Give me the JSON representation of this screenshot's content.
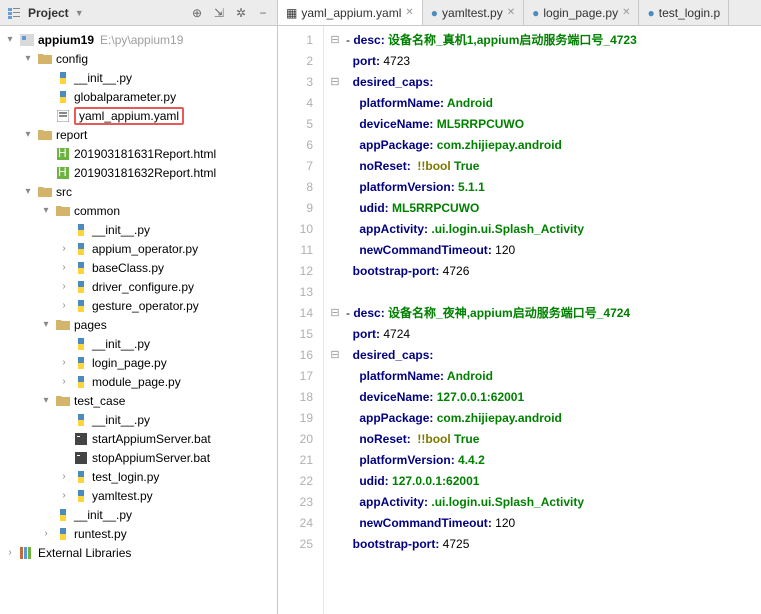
{
  "sidebar": {
    "title": "Project",
    "project_name": "appium19",
    "project_path": "E:\\py\\appium19",
    "nodes": {
      "config": "config",
      "init1": "__init__.py",
      "globalparam": "globalparameter.py",
      "yaml_appium": "yaml_appium.yaml",
      "report": "report",
      "rpt1": "201903181631Report.html",
      "rpt2": "201903181632Report.html",
      "src": "src",
      "common": "common",
      "init2": "__init__.py",
      "appium_op": "appium_operator.py",
      "baseclass": "baseClass.py",
      "driver_conf": "driver_configure.py",
      "gesture_op": "gesture_operator.py",
      "pages": "pages",
      "init3": "__init__.py",
      "login_page": "login_page.py",
      "module_page": "module_page.py",
      "test_case": "test_case",
      "init4": "__init__.py",
      "startAppium": "startAppiumServer.bat",
      "stopAppium": "stopAppiumServer.bat",
      "test_login": "test_login.py",
      "yamltest": "yamltest.py",
      "init5": "__init__.py",
      "runtest": "runtest.py",
      "extlib": "External Libraries"
    }
  },
  "tabs": {
    "t1": "yaml_appium.yaml",
    "t2": "yamltest.py",
    "t3": "login_page.py",
    "t4": "test_login.p"
  },
  "code": {
    "l1_k": "desc",
    "l1_v": "设备名称_真机1,appium启动服务端口号_4723",
    "l2_k": "port",
    "l2_v": "4723",
    "l3_k": "desired_caps",
    "l4_k": "platformName",
    "l4_v": "Android",
    "l5_k": "deviceName",
    "l5_v": "ML5RRPCUWO",
    "l6_k": "appPackage",
    "l6_v": "com.zhijiepay.android",
    "l7_k": "noReset",
    "l7_t": "!!bool",
    "l7_v": "True",
    "l8_k": "platformVersion",
    "l8_v": "5.1.1",
    "l9_k": "udid",
    "l9_v": "ML5RRPCUWO",
    "l10_k": "appActivity",
    "l10_v": ".ui.login.ui.Splash_Activity",
    "l11_k": "newCommandTimeout",
    "l11_v": "120",
    "l12_k": "bootstrap-port",
    "l12_v": "4726",
    "l14_k": "desc",
    "l14_v": "设备名称_夜神,appium启动服务端口号_4724",
    "l15_k": "port",
    "l15_v": "4724",
    "l16_k": "desired_caps",
    "l17_k": "platformName",
    "l17_v": "Android",
    "l18_k": "deviceName",
    "l18_v": "127.0.0.1:62001",
    "l19_k": "appPackage",
    "l19_v": "com.zhijiepay.android",
    "l20_k": "noReset",
    "l20_t": "!!bool",
    "l20_v": "True",
    "l21_k": "platformVersion",
    "l21_v": "4.4.2",
    "l22_k": "udid",
    "l22_v": "127.0.0.1:62001",
    "l23_k": "appActivity",
    "l23_v": ".ui.login.ui.Splash_Activity",
    "l24_k": "newCommandTimeout",
    "l24_v": "120",
    "l25_k": "bootstrap-port",
    "l25_v": "4725"
  }
}
